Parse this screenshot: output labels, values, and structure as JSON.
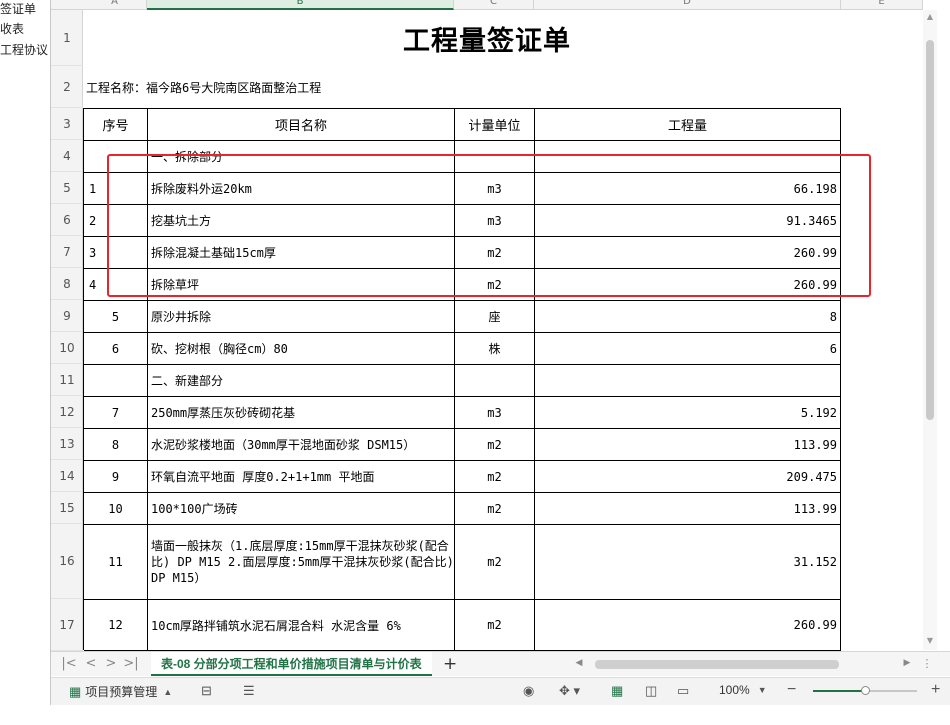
{
  "left_panel": {
    "items": [
      "签证单",
      "收表",
      "工程协议"
    ]
  },
  "columns": [
    "A",
    "B",
    "C",
    "D",
    "E"
  ],
  "active_column": "B",
  "sheet": {
    "title": "工程量签证单",
    "project_line": "工程名称：福今路6号大院南区路面整治工程",
    "headers": {
      "seq": "序号",
      "name": "项目名称",
      "unit": "计量单位",
      "qty": "工程量"
    },
    "row_numbers": [
      "1",
      "2",
      "3",
      "4",
      "5",
      "6",
      "7",
      "8",
      "9",
      "10",
      "11",
      "12",
      "13",
      "14",
      "15",
      "16",
      "17"
    ],
    "rows": [
      {
        "seq": "",
        "name": "一、拆除部分",
        "unit": "",
        "qty": ""
      },
      {
        "seq": "1",
        "name": "拆除废料外运20km",
        "unit": "m3",
        "qty": "66.198"
      },
      {
        "seq": "2",
        "name": "挖基坑土方",
        "unit": "m3",
        "qty": "91.3465"
      },
      {
        "seq": "3",
        "name": "拆除混凝土基础15cm厚",
        "unit": "m2",
        "qty": "260.99"
      },
      {
        "seq": "4",
        "name": "拆除草坪",
        "unit": "m2",
        "qty": "260.99"
      },
      {
        "seq": "5",
        "name": "原沙井拆除",
        "unit": "座",
        "qty": "8"
      },
      {
        "seq": "6",
        "name": "砍、挖树根（胸径cm）80",
        "unit": "株",
        "qty": "6"
      },
      {
        "seq": "",
        "name": "二、新建部分",
        "unit": "",
        "qty": ""
      },
      {
        "seq": "7",
        "name": "250mm厚蒸压灰砂砖砌花基",
        "unit": "m3",
        "qty": "5.192"
      },
      {
        "seq": "8",
        "name": "水泥砂浆楼地面（30mm厚干混地面砂浆 DSM15）",
        "unit": "m2",
        "qty": "113.99"
      },
      {
        "seq": "9",
        "name": "环氧自流平地面 厚度0.2+1+1mm 平地面",
        "unit": "m2",
        "qty": "209.475"
      },
      {
        "seq": "10",
        "name": "100*100广场砖",
        "unit": "m2",
        "qty": "113.99"
      },
      {
        "seq": "11",
        "name": "墙面一般抹灰（1.底层厚度:15mm厚干混抹灰砂浆(配合比) DP M15 2.面层厚度:5mm厚干混抹灰砂浆(配合比) DP M15）",
        "unit": "m2",
        "qty": "31.152"
      },
      {
        "seq": "12",
        "name": "10cm厚路拌铺筑水泥石屑混合料 水泥含量 6%",
        "unit": "m2",
        "qty": "260.99"
      }
    ]
  },
  "tabbar": {
    "active_tab": "表-08 分部分项工程和单价措施项目清单与计价表",
    "add_icon": "plus-icon"
  },
  "statusbar": {
    "project_label": "项目预算管理",
    "zoom": "100%",
    "zoom_level": 0.5
  },
  "colors": {
    "accent": "#217346",
    "highlight_border": "#e8252a"
  }
}
